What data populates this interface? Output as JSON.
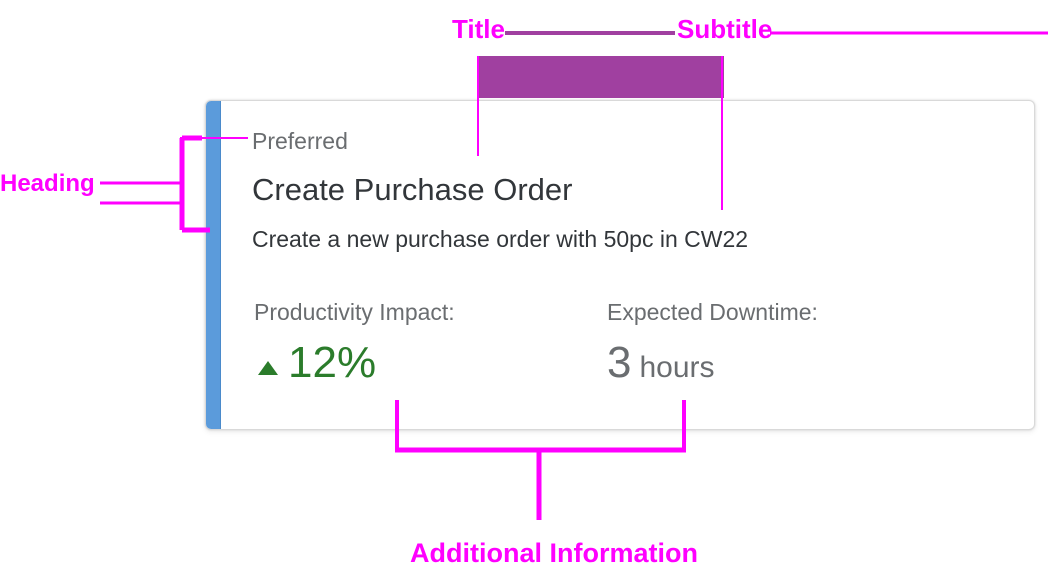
{
  "card": {
    "heading": "Preferred",
    "title": "Create Purchase Order",
    "subtitle": "Create a new purchase order with 50pc in CW22",
    "kpis": [
      {
        "label": "Productivity Impact:",
        "value": "12%",
        "unit": "",
        "trend": "up"
      },
      {
        "label": "Expected Downtime:",
        "value": "3",
        "unit": "hours"
      }
    ]
  },
  "annotations": {
    "title": "Title",
    "subtitle": "Subtitle",
    "heading": "Heading",
    "additional": "Additional Information"
  },
  "colors": {
    "accent_bar": "#5b9bdb",
    "positive": "#2b7c2b",
    "neutral_text": "#6a6d70",
    "annotation": "#ff00ff",
    "annotation_box": "#a040a0"
  }
}
